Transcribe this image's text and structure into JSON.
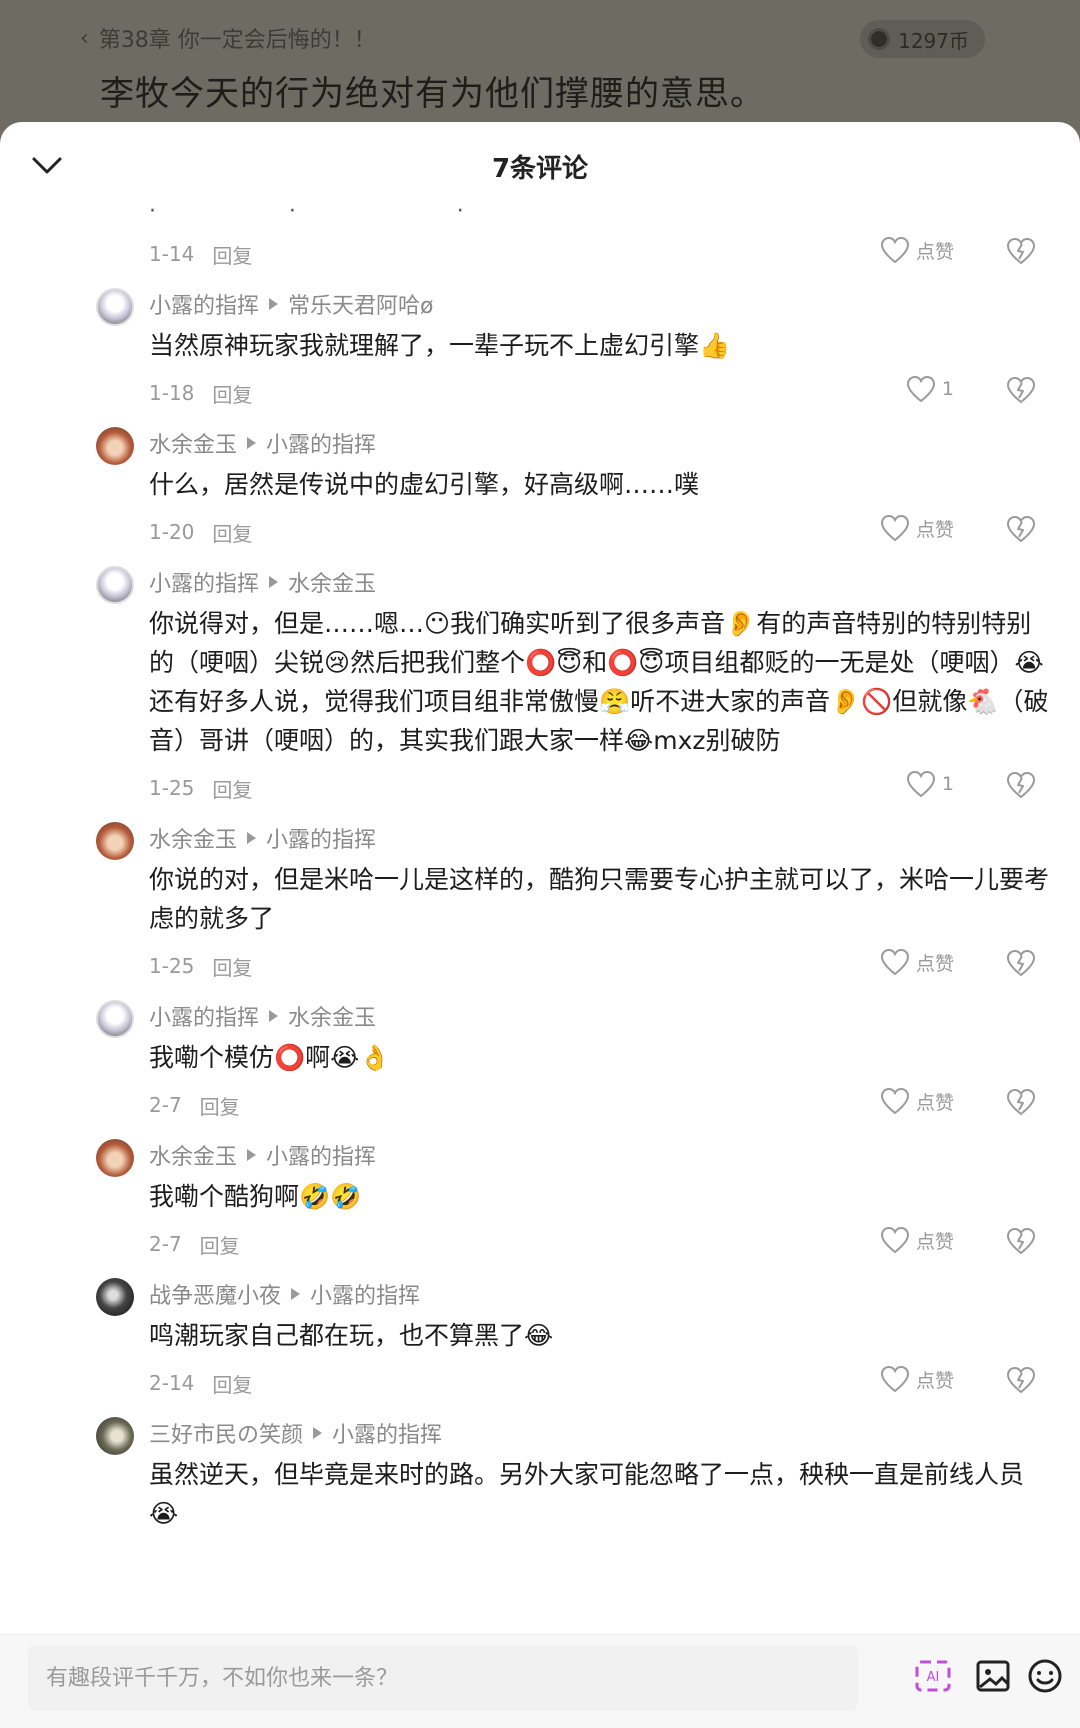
{
  "reader": {
    "chapter_title": "第38章 你一定会后悔的！！",
    "coins": "1297币",
    "novel_line": "李牧今天的行为绝对有为他们撑腰的意思。"
  },
  "sheet": {
    "title": "7条评论"
  },
  "first_meta": {
    "date": "1-14",
    "reply": "回复",
    "like": "点赞"
  },
  "comments": [
    {
      "user": "小露的指挥",
      "target": "常乐天君阿哈ø",
      "text": "当然原神玩家我就理解了，一辈子玩不上虚幻引擎👍",
      "date": "1-18",
      "reply": "回复",
      "like": "1",
      "avatar": "avatar-anime"
    },
    {
      "user": "水余金玉",
      "target": "小露的指挥",
      "text": "什么，居然是传说中的虚幻引擎，好高级啊……噗",
      "date": "1-20",
      "reply": "回复",
      "like": "点赞",
      "avatar": "avatar-portrait"
    },
    {
      "user": "小露的指挥",
      "target": "水余金玉",
      "text": "你说得对，但是……嗯…😶我们确实听到了很多声音👂有的声音特别的特别特别的（哽咽）尖锐😢然后把我们整个⭕😇和⭕😇项目组都贬的一无是处（哽咽）😭还有好多人说，觉得我们项目组非常傲慢😤听不进大家的声音👂🚫但就像🐔（破音）哥讲（哽咽）的，其实我们跟大家一样😂mxz别破防",
      "date": "1-25",
      "reply": "回复",
      "like": "1",
      "avatar": "avatar-anime"
    },
    {
      "user": "水余金玉",
      "target": "小露的指挥",
      "text": "你说的对，但是米哈一儿是这样的，酷狗只需要专心护主就可以了，米哈一儿要考虑的就多了",
      "date": "1-25",
      "reply": "回复",
      "like": "点赞",
      "avatar": "avatar-portrait"
    },
    {
      "user": "小露的指挥",
      "target": "水余金玉",
      "text": "我嘞个模仿⭕啊😭👌",
      "date": "2-7",
      "reply": "回复",
      "like": "点赞",
      "avatar": "avatar-anime"
    },
    {
      "user": "水余金玉",
      "target": "小露的指挥",
      "text": "我嘞个酷狗啊🤣🤣",
      "date": "2-7",
      "reply": "回复",
      "like": "点赞",
      "avatar": "avatar-portrait"
    },
    {
      "user": "战争恶魔小夜",
      "target": "小露的指挥",
      "text": "鸣潮玩家自己都在玩，也不算黑了😂",
      "date": "2-14",
      "reply": "回复",
      "like": "点赞",
      "avatar": "avatar-dark"
    },
    {
      "user": "三好市民の笑颜",
      "target": "小露的指挥",
      "text": "虽然逆天，但毕竟是来时的路。另外大家可能忽略了一点，秧秧一直是前线人员😭",
      "date": "",
      "reply": "",
      "like": "",
      "avatar": "avatar-sketch"
    }
  ],
  "composer": {
    "placeholder": "有趣段评千千万，不如你也来一条？"
  },
  "icons": {
    "collapse": "chevron-down-icon",
    "like": "heart-outline-icon",
    "dislike": "broken-heart-icon",
    "ai": "ai-icon",
    "image": "image-icon",
    "emoji": "emoji-icon"
  }
}
